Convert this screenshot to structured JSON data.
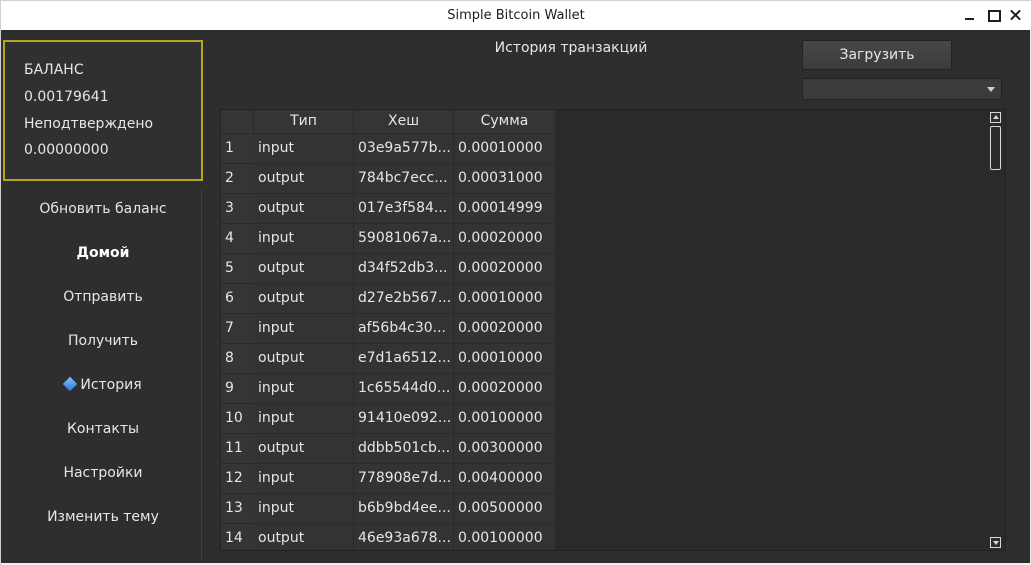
{
  "window": {
    "title": "Simple Bitcoin Wallet"
  },
  "balance": {
    "label": "БАЛАНС",
    "value": "0.00179641",
    "unconfirmed_label": "Неподтверждено",
    "unconfirmed_value": "0.00000000",
    "border_color": "#b9a21e"
  },
  "sidebar": {
    "items": [
      {
        "label": "Обновить баланс",
        "active": false
      },
      {
        "label": "Домой",
        "active": true
      },
      {
        "label": "Отправить",
        "active": false
      },
      {
        "label": "Получить",
        "active": false
      },
      {
        "label": "История",
        "active": false,
        "icon": "blue-diamond-icon"
      },
      {
        "label": "Контакты",
        "active": false
      },
      {
        "label": "Настройки",
        "active": false
      },
      {
        "label": "Изменить тему",
        "active": false
      }
    ]
  },
  "main": {
    "title": "История транзакций",
    "load_button": "Загрузить",
    "combo_value": "",
    "table": {
      "headers": [
        "Тип",
        "Хеш",
        "Сумма"
      ],
      "rows": [
        {
          "n": "1",
          "type": "input",
          "hash": "03e9a577b...",
          "sum": "0.00010000"
        },
        {
          "n": "2",
          "type": "output",
          "hash": "784bc7ecc...",
          "sum": "0.00031000"
        },
        {
          "n": "3",
          "type": "output",
          "hash": "017e3f584...",
          "sum": "0.00014999"
        },
        {
          "n": "4",
          "type": "input",
          "hash": "59081067a...",
          "sum": "0.00020000"
        },
        {
          "n": "5",
          "type": "output",
          "hash": "d34f52db3...",
          "sum": "0.00020000"
        },
        {
          "n": "6",
          "type": "output",
          "hash": "d27e2b567...",
          "sum": "0.00010000"
        },
        {
          "n": "7",
          "type": "input",
          "hash": "af56b4c30...",
          "sum": "0.00020000"
        },
        {
          "n": "8",
          "type": "output",
          "hash": "e7d1a6512...",
          "sum": "0.00010000"
        },
        {
          "n": "9",
          "type": "input",
          "hash": "1c65544d0...",
          "sum": "0.00020000"
        },
        {
          "n": "10",
          "type": "input",
          "hash": "91410e092...",
          "sum": "0.00100000"
        },
        {
          "n": "11",
          "type": "output",
          "hash": "ddbb501cb...",
          "sum": "0.00300000"
        },
        {
          "n": "12",
          "type": "input",
          "hash": "778908e7d...",
          "sum": "0.00400000"
        },
        {
          "n": "13",
          "type": "input",
          "hash": "b6b9bd4ee...",
          "sum": "0.00500000"
        },
        {
          "n": "14",
          "type": "output",
          "hash": "46e93a678...",
          "sum": "0.00100000"
        }
      ]
    }
  },
  "scrollbar": {
    "position": 0
  }
}
